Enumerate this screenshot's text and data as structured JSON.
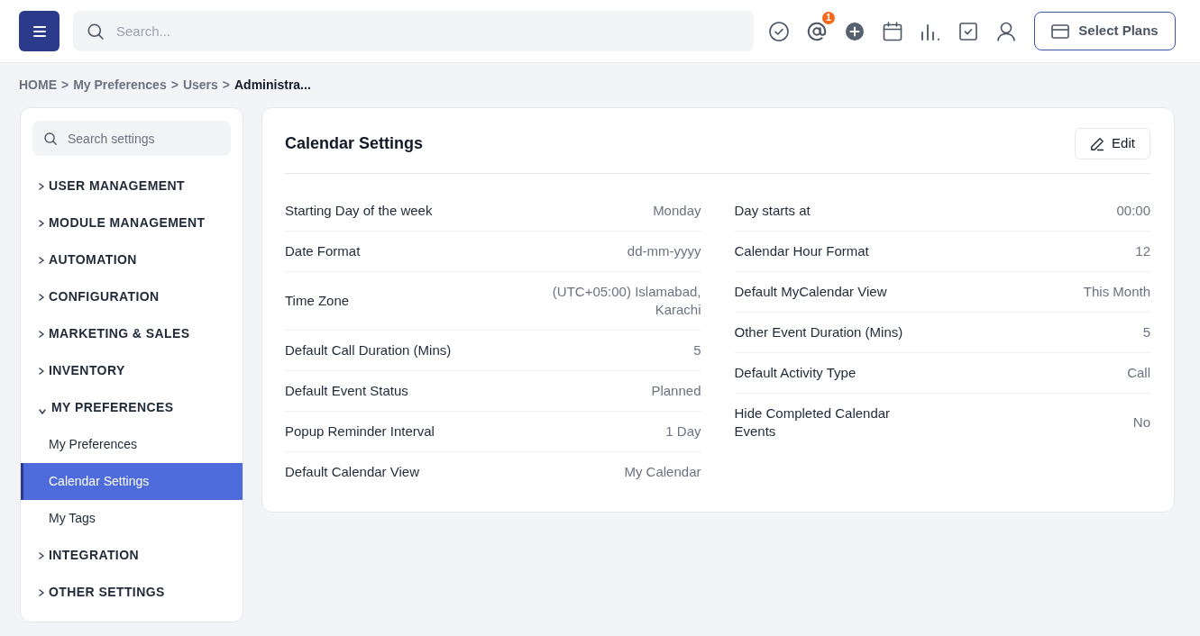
{
  "header": {
    "search": {
      "placeholder": "Search..."
    },
    "mention_count": "1",
    "plans_button": "Select Plans"
  },
  "breadcrumb": [
    {
      "label": "HOME",
      "separator": ">",
      "current": false
    },
    {
      "label": "My Preferences",
      "separator": ">",
      "current": false
    },
    {
      "label": "Users",
      "separator": ">",
      "current": false
    },
    {
      "label": "Administra...",
      "current": true
    }
  ],
  "sidebar": {
    "search": {
      "placeholder": "Search settings"
    },
    "sections": [
      {
        "label": "USER MANAGEMENT",
        "expanded": false
      },
      {
        "label": "MODULE MANAGEMENT",
        "expanded": false
      },
      {
        "label": "AUTOMATION",
        "expanded": false
      },
      {
        "label": "CONFIGURATION",
        "expanded": false
      },
      {
        "label": "MARKETING & SALES",
        "expanded": false
      },
      {
        "label": "INVENTORY",
        "expanded": false
      },
      {
        "label": "MY PREFERENCES",
        "expanded": true,
        "children": [
          {
            "label": "My Preferences",
            "selected": false
          },
          {
            "label": "Calendar Settings",
            "selected": true
          },
          {
            "label": "My Tags",
            "selected": false
          }
        ]
      },
      {
        "label": "INTEGRATION",
        "expanded": false
      },
      {
        "label": "OTHER SETTINGS",
        "expanded": false
      }
    ]
  },
  "panel": {
    "title": "Calendar Settings",
    "edit_button": "Edit",
    "columns": [
      {
        "rows": [
          {
            "label": "Starting Day of the week",
            "value": "Monday"
          },
          {
            "label": "Date Format",
            "value": "dd-mm-yyyy"
          },
          {
            "label": "Time Zone",
            "value": "(UTC+05:00) Islamabad, Karachi"
          },
          {
            "label": "Default Call Duration (Mins)",
            "value": "5"
          },
          {
            "label": "Default Event Status",
            "value": "Planned"
          },
          {
            "label": "Popup Reminder Interval",
            "value": "1 Day"
          },
          {
            "label": "Default Calendar View",
            "value": "My Calendar"
          }
        ]
      },
      {
        "rows": [
          {
            "label": "Day starts at",
            "value": "00:00"
          },
          {
            "label": "Calendar Hour Format",
            "value": "12"
          },
          {
            "label": "Default MyCalendar View",
            "value": "This Month"
          },
          {
            "label": "Other Event Duration (Mins)",
            "value": "5"
          },
          {
            "label": "Default Activity Type",
            "value": "Call"
          },
          {
            "label": "Hide Completed Calendar Events",
            "value": "No"
          }
        ]
      }
    ]
  }
}
